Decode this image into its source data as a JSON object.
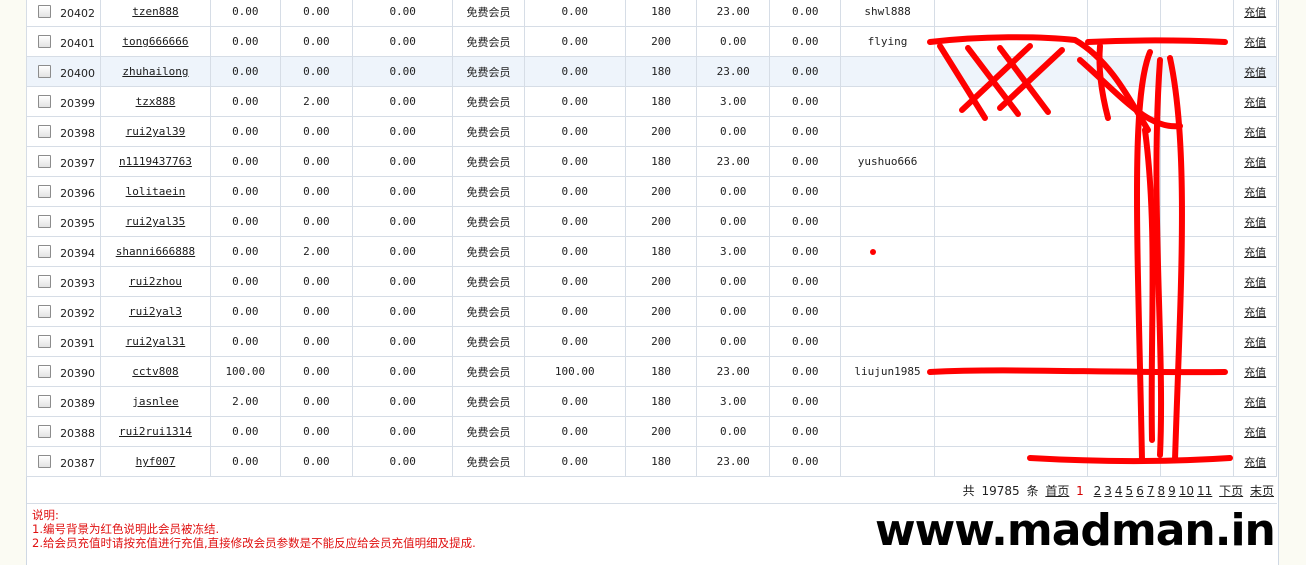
{
  "rows": [
    {
      "id": "20402",
      "user": "tzen888",
      "c1": "0.00",
      "c2": "0.00",
      "c3": "0.00",
      "type": "免费会员",
      "c5": "0.00",
      "c6": "180",
      "c7": "23.00",
      "c8": "0.00",
      "ref": "shwl888",
      "bank": "",
      "name": "",
      "phone": "",
      "action": "充值"
    },
    {
      "id": "20401",
      "user": "tong666666",
      "c1": "0.00",
      "c2": "0.00",
      "c3": "0.00",
      "type": "免费会员",
      "c5": "0.00",
      "c6": "200",
      "c7": "0.00",
      "c8": "0.00",
      "ref": "flying",
      "bank": "",
      "name": "",
      "phone": "",
      "action": "充值"
    },
    {
      "id": "20400",
      "user": "zhuhailong",
      "c1": "0.00",
      "c2": "0.00",
      "c3": "0.00",
      "type": "免费会员",
      "c5": "0.00",
      "c6": "180",
      "c7": "23.00",
      "c8": "0.00",
      "ref": "",
      "bank": "",
      "name": "",
      "phone": "",
      "action": "充值"
    },
    {
      "id": "20399",
      "user": "tzx888",
      "c1": "0.00",
      "c2": "2.00",
      "c3": "0.00",
      "type": "免费会员",
      "c5": "0.00",
      "c6": "180",
      "c7": "3.00",
      "c8": "0.00",
      "ref": "",
      "bank": "",
      "name": "",
      "phone": "",
      "action": "充值"
    },
    {
      "id": "20398",
      "user": "rui2yal39",
      "c1": "0.00",
      "c2": "0.00",
      "c3": "0.00",
      "type": "免费会员",
      "c5": "0.00",
      "c6": "200",
      "c7": "0.00",
      "c8": "0.00",
      "ref": "",
      "bank": "",
      "name": "",
      "phone": "",
      "action": "充值"
    },
    {
      "id": "20397",
      "user": "n1119437763",
      "c1": "0.00",
      "c2": "0.00",
      "c3": "0.00",
      "type": "免费会员",
      "c5": "0.00",
      "c6": "180",
      "c7": "23.00",
      "c8": "0.00",
      "ref": "yushuo666",
      "bank": "",
      "name": "",
      "phone": "",
      "action": "充值"
    },
    {
      "id": "20396",
      "user": "lolitaein",
      "c1": "0.00",
      "c2": "0.00",
      "c3": "0.00",
      "type": "免费会员",
      "c5": "0.00",
      "c6": "200",
      "c7": "0.00",
      "c8": "0.00",
      "ref": "",
      "bank": "",
      "name": "",
      "phone": "",
      "action": "充值"
    },
    {
      "id": "20395",
      "user": "rui2yal35",
      "c1": "0.00",
      "c2": "0.00",
      "c3": "0.00",
      "type": "免费会员",
      "c5": "0.00",
      "c6": "200",
      "c7": "0.00",
      "c8": "0.00",
      "ref": "",
      "bank": "",
      "name": "",
      "phone": "",
      "action": "充值"
    },
    {
      "id": "20394",
      "user": "shanni666888",
      "c1": "0.00",
      "c2": "2.00",
      "c3": "0.00",
      "type": "免费会员",
      "c5": "0.00",
      "c6": "180",
      "c7": "3.00",
      "c8": "0.00",
      "ref": "",
      "bank": "",
      "name": "",
      "phone": "",
      "action": "充值"
    },
    {
      "id": "20393",
      "user": "rui2zhou",
      "c1": "0.00",
      "c2": "0.00",
      "c3": "0.00",
      "type": "免费会员",
      "c5": "0.00",
      "c6": "200",
      "c7": "0.00",
      "c8": "0.00",
      "ref": "",
      "bank": "",
      "name": "",
      "phone": "",
      "action": "充值"
    },
    {
      "id": "20392",
      "user": "rui2yal3",
      "c1": "0.00",
      "c2": "0.00",
      "c3": "0.00",
      "type": "免费会员",
      "c5": "0.00",
      "c6": "200",
      "c7": "0.00",
      "c8": "0.00",
      "ref": "",
      "bank": "",
      "name": "",
      "phone": "",
      "action": "充值"
    },
    {
      "id": "20391",
      "user": "rui2yal31",
      "c1": "0.00",
      "c2": "0.00",
      "c3": "0.00",
      "type": "免费会员",
      "c5": "0.00",
      "c6": "200",
      "c7": "0.00",
      "c8": "0.00",
      "ref": "",
      "bank": "",
      "name": "",
      "phone": "",
      "action": "充值"
    },
    {
      "id": "20390",
      "user": "cctv808",
      "c1": "100.00",
      "c2": "0.00",
      "c3": "0.00",
      "type": "免费会员",
      "c5": "100.00",
      "c6": "180",
      "c7": "23.00",
      "c8": "0.00",
      "ref": "liujun1985",
      "bank": "",
      "name": "",
      "phone": "",
      "action": "充值"
    },
    {
      "id": "20389",
      "user": "jasnlee",
      "c1": "2.00",
      "c2": "0.00",
      "c3": "0.00",
      "type": "免费会员",
      "c5": "0.00",
      "c6": "180",
      "c7": "3.00",
      "c8": "0.00",
      "ref": "",
      "bank": "",
      "name": "",
      "phone": "",
      "action": "充值"
    },
    {
      "id": "20388",
      "user": "rui2rui1314",
      "c1": "0.00",
      "c2": "0.00",
      "c3": "0.00",
      "type": "免费会员",
      "c5": "0.00",
      "c6": "200",
      "c7": "0.00",
      "c8": "0.00",
      "ref": "",
      "bank": "",
      "name": "",
      "phone": "",
      "action": "充值"
    },
    {
      "id": "20387",
      "user": "hyf007",
      "c1": "0.00",
      "c2": "0.00",
      "c3": "0.00",
      "type": "免费会员",
      "c5": "0.00",
      "c6": "180",
      "c7": "23.00",
      "c8": "0.00",
      "ref": "",
      "bank": "",
      "name": "",
      "phone": "",
      "action": "充值"
    }
  ],
  "pagination": {
    "total_prefix": "共",
    "total": "19785",
    "total_suffix": "条",
    "first": "首页",
    "current": "1",
    "pages": [
      "2",
      "3",
      "4",
      "5",
      "6",
      "7",
      "8",
      "9",
      "10",
      "11"
    ],
    "next": "下页",
    "last": "末页"
  },
  "notes": {
    "title": "说明:",
    "line1": "1.编号背景为红色说明此会员被冻结.",
    "line2": "2.给会员充值时请按充值进行充值,直接修改会员参数是不能反应给会员充值明细及提成."
  },
  "watermark": "www.madman.in",
  "colors": {
    "scribble": "#ff0000",
    "note_text": "#e01010",
    "watermark": "#000000"
  },
  "highlight_row_index": 2
}
